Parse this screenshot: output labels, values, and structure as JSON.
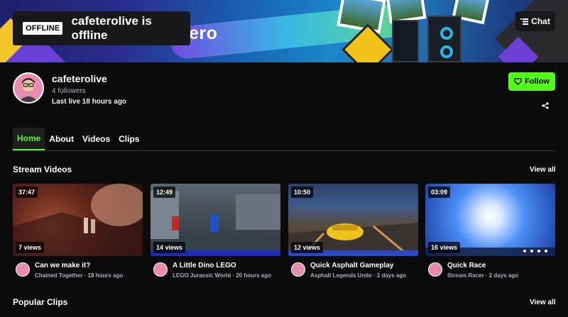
{
  "banner": {
    "brand_text": "ero",
    "offline_badge": "OFFLINE",
    "offline_text": "cafeterolive is offline",
    "chat_label": "Chat"
  },
  "profile": {
    "name": "cafeterolive",
    "followers": "4 followers",
    "last_live": "Last live 18 hours ago",
    "follow_label": "Follow"
  },
  "tabs": [
    {
      "label": "Home",
      "active": true
    },
    {
      "label": "About",
      "active": false
    },
    {
      "label": "Videos",
      "active": false
    },
    {
      "label": "Clips",
      "active": false
    }
  ],
  "stream_videos": {
    "title": "Stream Videos",
    "view_all": "View all",
    "items": [
      {
        "duration": "37:47",
        "views": "7 views",
        "title": "Can we make it?",
        "sub": "Chained Together · 18 hours ago"
      },
      {
        "duration": "12:49",
        "views": "14 views",
        "title": "A Little Dino LEGO",
        "sub": "LEGO Jurassic World · 20 hours ago"
      },
      {
        "duration": "10:50",
        "views": "12 views",
        "title": "Quick Asphalt Gameplay",
        "sub": "Asphalt Legends Unite · 2 days ago"
      },
      {
        "duration": "03:09",
        "views": "16 views",
        "title": "Quick Race",
        "sub": "Stream Racer · 2 days ago"
      }
    ]
  },
  "popular_clips": {
    "title": "Popular Clips",
    "view_all": "View all"
  },
  "colors": {
    "accent": "#53fc18",
    "background": "#0b0b0c",
    "muted_text": "#adadb8"
  }
}
